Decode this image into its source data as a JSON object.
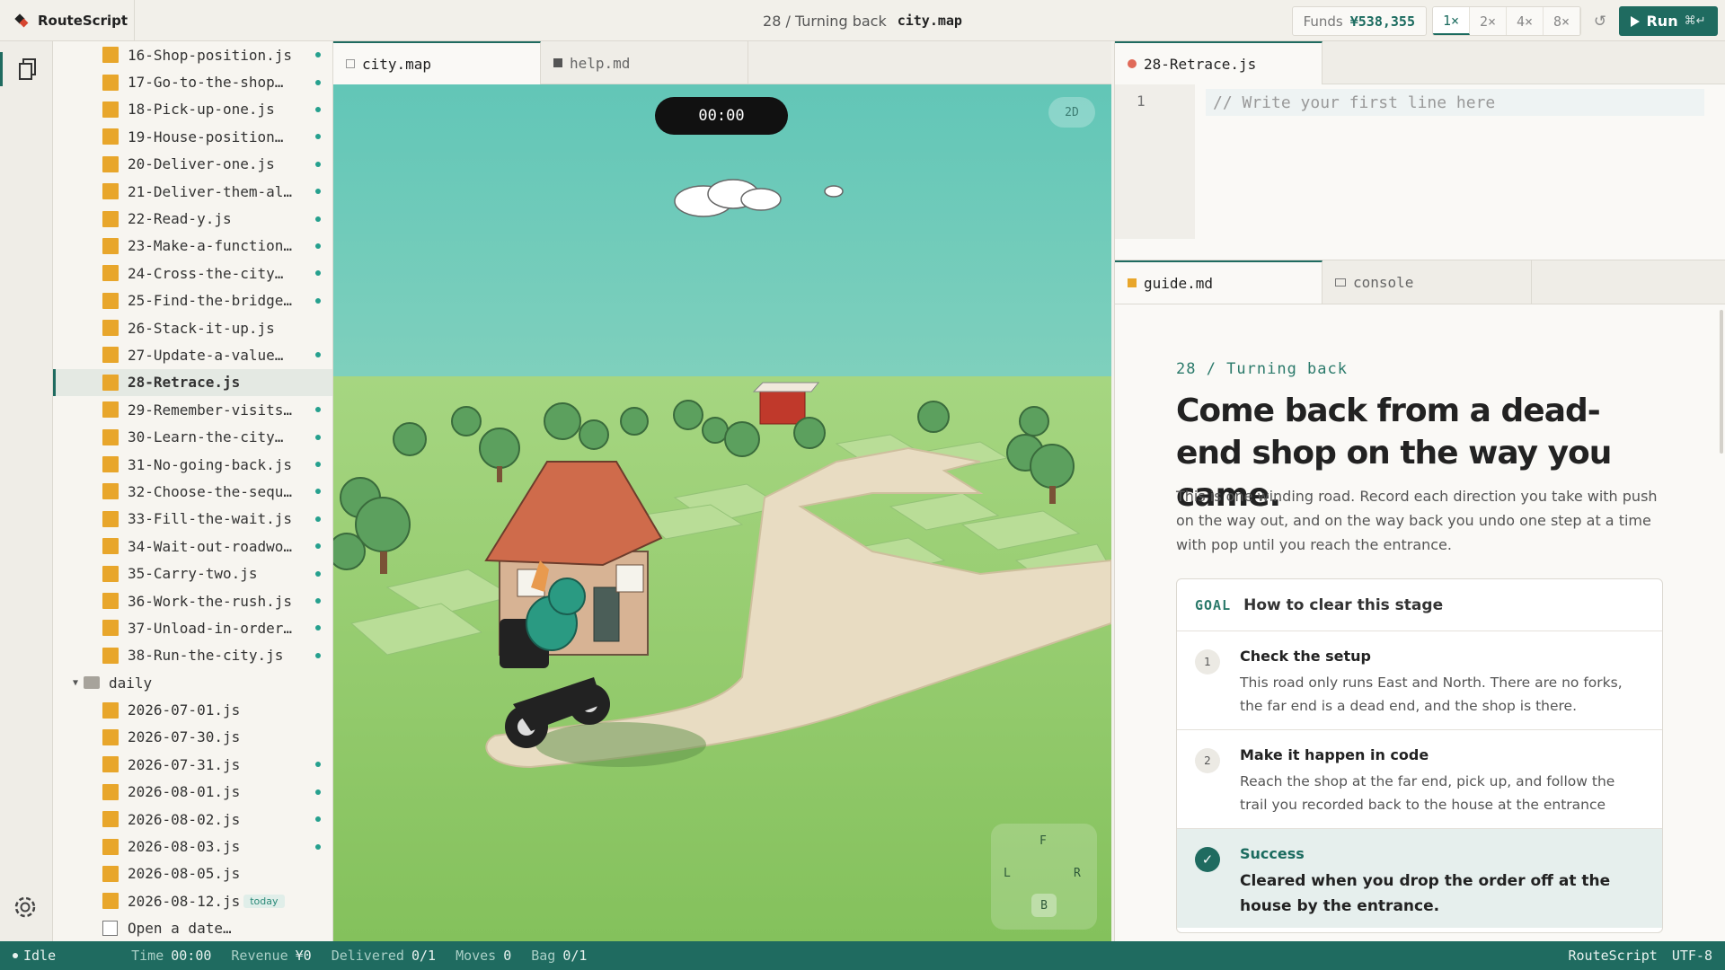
{
  "app": {
    "name": "RouteScript"
  },
  "header": {
    "breadcrumb": "28 / Turning back",
    "file": "city.map",
    "funds_label": "Funds",
    "funds_value": "¥538,355",
    "speeds": [
      "1×",
      "2×",
      "4×",
      "8×"
    ],
    "reset_icon": "↺",
    "run_label": "Run",
    "run_shortcut": "⌘↵"
  },
  "tree": {
    "items": [
      {
        "name": "16-Shop-position.js",
        "dot": true
      },
      {
        "name": "17-Go-to-the-shop…",
        "dot": true
      },
      {
        "name": "18-Pick-up-one.js",
        "dot": true
      },
      {
        "name": "19-House-position…",
        "dot": true
      },
      {
        "name": "20-Deliver-one.js",
        "dot": true
      },
      {
        "name": "21-Deliver-them-al…",
        "dot": true
      },
      {
        "name": "22-Read-y.js",
        "dot": true
      },
      {
        "name": "23-Make-a-function…",
        "dot": true
      },
      {
        "name": "24-Cross-the-city…",
        "dot": true
      },
      {
        "name": "25-Find-the-bridge…",
        "dot": true
      },
      {
        "name": "26-Stack-it-up.js",
        "dot": false
      },
      {
        "name": "27-Update-a-value…",
        "dot": true
      },
      {
        "name": "28-Retrace.js",
        "dot": false,
        "selected": true
      },
      {
        "name": "29-Remember-visits…",
        "dot": true
      },
      {
        "name": "30-Learn-the-city…",
        "dot": true
      },
      {
        "name": "31-No-going-back.js",
        "dot": true
      },
      {
        "name": "32-Choose-the-sequ…",
        "dot": true
      },
      {
        "name": "33-Fill-the-wait.js",
        "dot": true
      },
      {
        "name": "34-Wait-out-roadwo…",
        "dot": true
      },
      {
        "name": "35-Carry-two.js",
        "dot": true
      },
      {
        "name": "36-Work-the-rush.js",
        "dot": true
      },
      {
        "name": "37-Unload-in-order…",
        "dot": true
      },
      {
        "name": "38-Run-the-city.js",
        "dot": true
      }
    ],
    "folder": "daily",
    "daily": [
      {
        "name": "2026-07-01.js",
        "dot": false
      },
      {
        "name": "2026-07-30.js",
        "dot": false
      },
      {
        "name": "2026-07-31.js",
        "dot": true
      },
      {
        "name": "2026-08-01.js",
        "dot": true
      },
      {
        "name": "2026-08-02.js",
        "dot": true
      },
      {
        "name": "2026-08-03.js",
        "dot": true
      },
      {
        "name": "2026-08-05.js",
        "dot": false
      },
      {
        "name": "2026-08-12.js",
        "dot": false,
        "badge": "today"
      }
    ],
    "open_date": "Open a date…"
  },
  "center_tabs": [
    {
      "label": "city.map"
    },
    {
      "label": "help.md"
    }
  ],
  "game": {
    "timer": "00:00",
    "mode": "2D",
    "dpad": {
      "up": "F",
      "left": "L",
      "right": "R",
      "down": "B"
    }
  },
  "editor": {
    "tab": "28-Retrace.js",
    "line_number": "1",
    "placeholder": "// Write your first line here"
  },
  "guide_tabs": [
    {
      "label": "guide.md"
    },
    {
      "label": "console"
    }
  ],
  "guide": {
    "crumb": "28 / Turning back",
    "title": "Come back from a dead-end shop on the way you came.",
    "intro": "This is one winding road. Record each direction you take with push on the way out, and on the way back you undo one step at a time with pop until you reach the entrance.",
    "goal_tag": "GOAL",
    "goal_title": "How to clear this stage",
    "steps": [
      {
        "num": "1",
        "title": "Check the setup",
        "desc": "This road only runs East and North. There are no forks, the far end is a dead end, and the shop is there."
      },
      {
        "num": "2",
        "title": "Make it happen in code",
        "desc": "Reach the shop at the far end, pick up, and follow the trail you recorded back to the house at the entrance"
      }
    ],
    "success": {
      "mark": "✓",
      "title": "Success",
      "desc": "Cleared when you drop the order off at the house by the entrance."
    }
  },
  "status": {
    "state": "Idle",
    "time_k": "Time",
    "time_v": "00:00",
    "revenue_k": "Revenue",
    "revenue_v": "¥0",
    "delivered_k": "Delivered",
    "delivered_v": "0/1",
    "moves_k": "Moves",
    "moves_v": "0",
    "bag_k": "Bag",
    "bag_v": "0/1",
    "app": "RouteScript",
    "encoding": "UTF-8"
  },
  "colors": {
    "accent": "#1f6b60",
    "file_icon": "#e8a62b",
    "sky": "#6fcab8",
    "grass": "#8cc466"
  }
}
